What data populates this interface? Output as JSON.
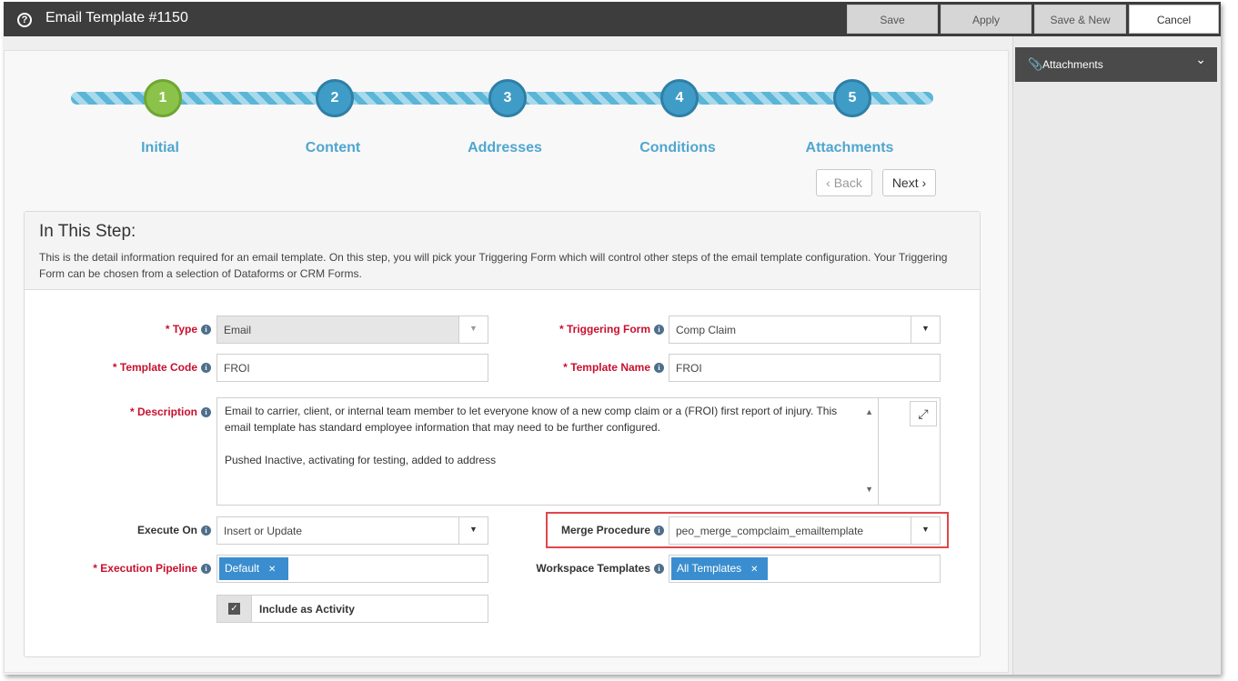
{
  "window": {
    "title": "Email Template #1150",
    "help_icon": "question-circle-icon"
  },
  "toolbar": {
    "save": "Save",
    "apply": "Apply",
    "save_new": "Save & New",
    "cancel": "Cancel"
  },
  "steps": [
    {
      "number": "1",
      "label": "Initial",
      "active": true
    },
    {
      "number": "2",
      "label": "Content",
      "active": false
    },
    {
      "number": "3",
      "label": "Addresses",
      "active": false
    },
    {
      "number": "4",
      "label": "Conditions",
      "active": false
    },
    {
      "number": "5",
      "label": "Attachments",
      "active": false
    }
  ],
  "nav": {
    "back": "Back",
    "next": "Next"
  },
  "step_info": {
    "title": "In This Step:",
    "description": "This is the detail information required for an email template. On this step, you will pick your Triggering Form which will control other steps of the email template configuration. Your Triggering Form can be chosen from a selection of Dataforms or CRM Forms."
  },
  "form": {
    "type": {
      "label": "Type",
      "value": "Email",
      "required": true
    },
    "triggering_form": {
      "label": "Triggering Form",
      "value": "Comp Claim",
      "required": true
    },
    "template_code": {
      "label": "Template Code",
      "value": "FROI",
      "required": true
    },
    "template_name": {
      "label": "Template Name",
      "value": "FROI",
      "required": true
    },
    "description": {
      "label": "Description",
      "required": true,
      "line1": "Email to carrier, client, or internal team member to let everyone know of a new comp claim or a (FROI) first report of injury. This email template has standard employee information that may need to be further configured.",
      "line2": "Pushed Inactive, activating for testing, added to address"
    },
    "execute_on": {
      "label": "Execute On",
      "value": "Insert or Update",
      "required": false
    },
    "merge_procedure": {
      "label": "Merge Procedure",
      "value": "peo_merge_compclaim_emailtemplate",
      "required": false
    },
    "execution_pipeline": {
      "label": "Execution Pipeline",
      "tag": "Default",
      "required": true
    },
    "workspace_templates": {
      "label": "Workspace Templates",
      "tag": "All Templates",
      "required": false
    },
    "include_activity": {
      "label": "Include as Activity",
      "checked": true
    }
  },
  "attachments_panel": {
    "title": "Attachments",
    "icon": "paperclip-icon"
  },
  "colors": {
    "titlebar": "#3d3d3d",
    "step_active": "#8bc34a",
    "step": "#3f9cc6",
    "required": "#c8102e",
    "tag": "#3a8ecf",
    "highlight": "#e0474c"
  }
}
